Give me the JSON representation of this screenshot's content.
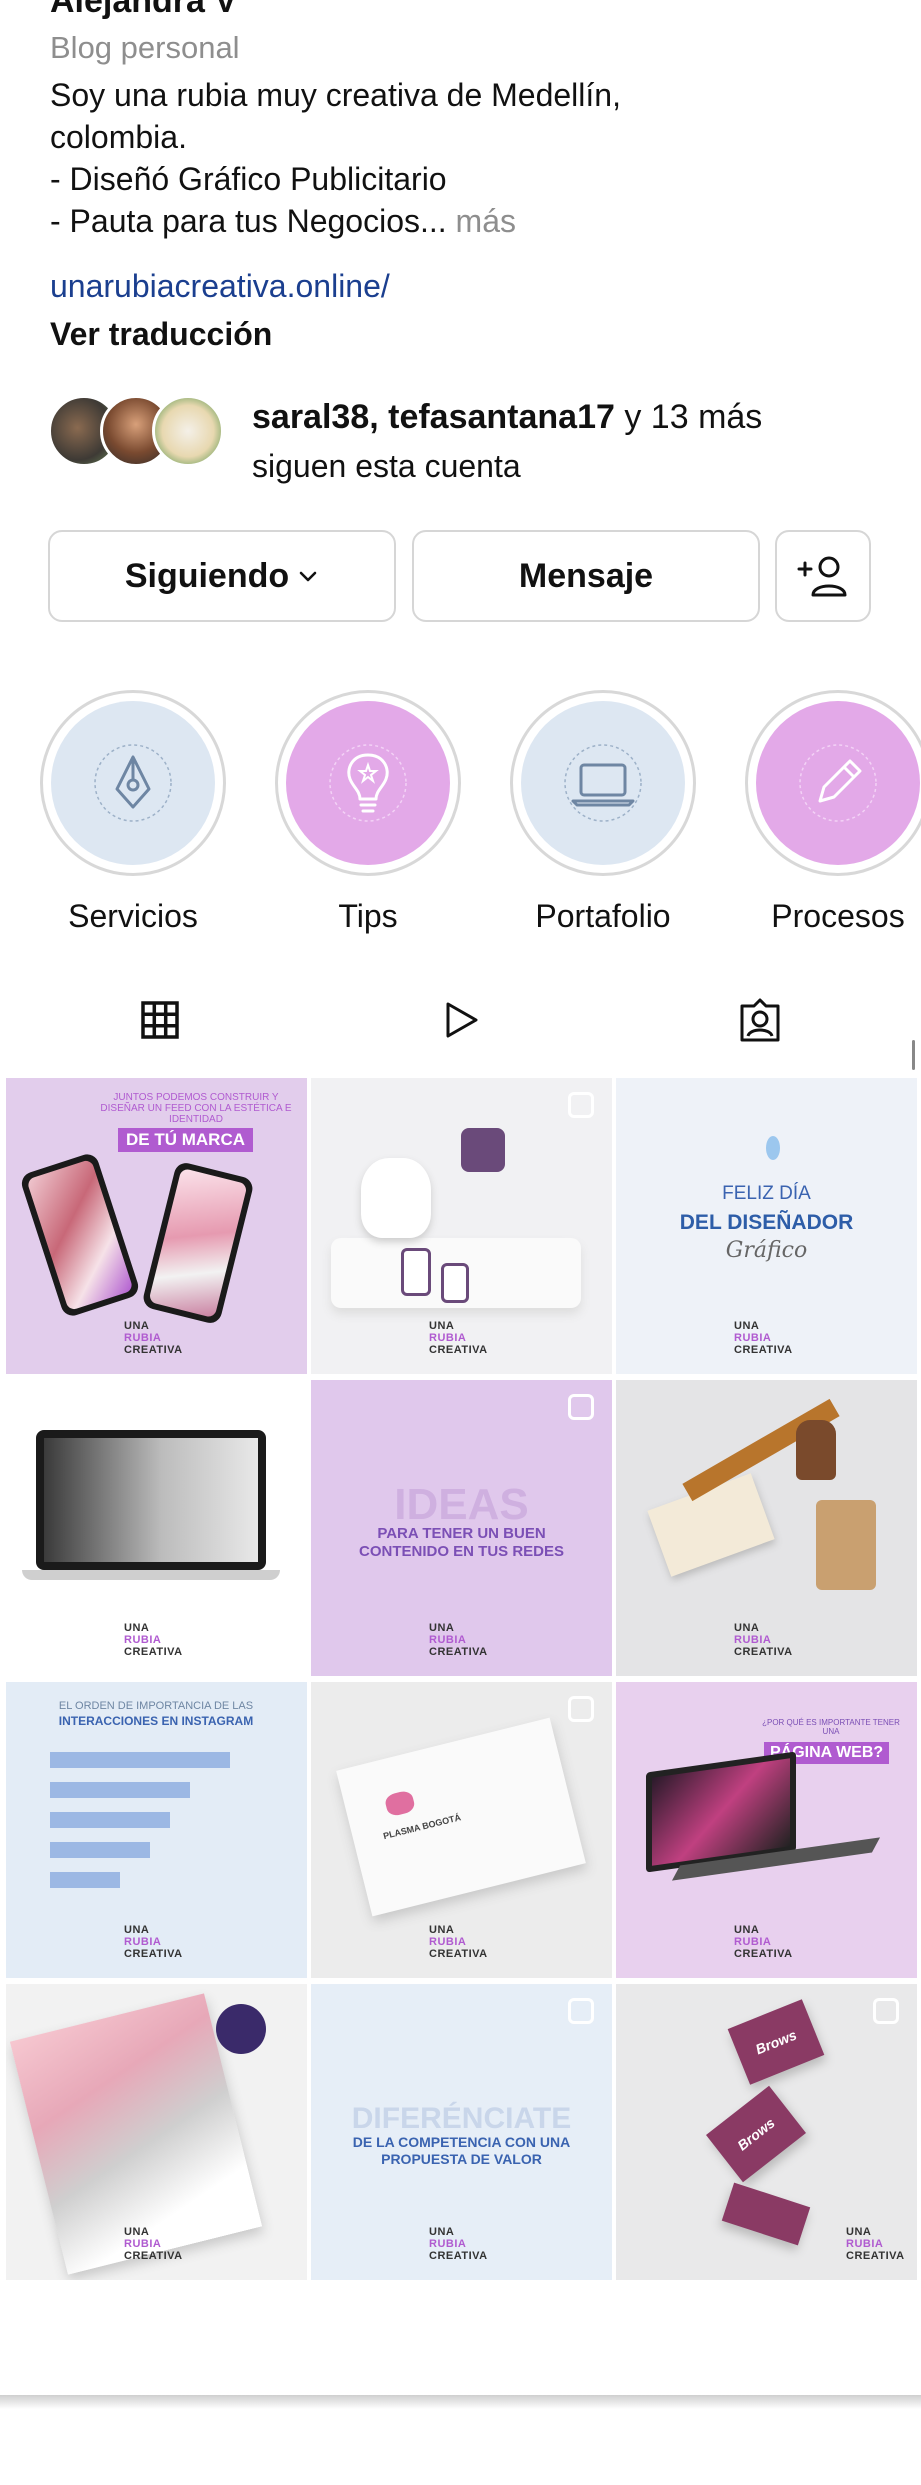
{
  "profile": {
    "name": "Alejandra V",
    "category": "Blog personal",
    "bio_lines": [
      "Soy una rubia muy creativa de Medellín,",
      "colombia.",
      "- Diseñó Gráfico Publicitario",
      "- Pauta para tus Negocios..."
    ],
    "more": "más",
    "link": "unarubiacreativa.online/",
    "translate": "Ver traducción"
  },
  "followed_by": {
    "names": "saral38, tefasantana17",
    "connector": "y 13 más",
    "suffix": "siguen esta cuenta"
  },
  "buttons": {
    "following": "Siguiendo",
    "message": "Mensaje",
    "add_user_icon": "add-user-icon"
  },
  "highlights": [
    {
      "label": "Servicios",
      "color": "#dde7f2",
      "icon": "pen-tool-icon"
    },
    {
      "label": "Tips",
      "color": "#e3a9e8",
      "icon": "lightbulb-icon"
    },
    {
      "label": "Portafolio",
      "color": "#dde7f2",
      "icon": "laptop-icon"
    },
    {
      "label": "Procesos",
      "color": "#e3a9e8",
      "icon": "pencil-icon"
    }
  ],
  "ring_text": "UNA RUBIA CREATIVA",
  "tabs": [
    "grid-icon",
    "reels-icon",
    "tagged-icon"
  ],
  "posts": [
    {
      "bg": "#e2cdec",
      "t1": "JUNTOS PODEMOS CONSTRUIR Y DISEÑAR UN FEED CON LA ESTÉTICA E IDENTIDAD",
      "t2": "DE TÚ MARCA",
      "t2color": "#ffffff",
      "t2bg": "#b05bd0"
    },
    {
      "bg": "#f1f1f3",
      "t1": "",
      "t2": "",
      "t2color": "#111",
      "t2bg": "transparent"
    },
    {
      "bg": "#eef2f8",
      "t1": "FELIZ DÍA",
      "t2": "DEL DISEÑADOR",
      "t2color": "#2d5da8",
      "t2bg": "transparent",
      "t3": "Gráfico"
    },
    {
      "bg": "#ffffff",
      "t1": "",
      "t2": "",
      "t2color": "#111",
      "t2bg": "transparent"
    },
    {
      "bg": "#e0c8ec",
      "t1": "IDEAS",
      "t2": "PARA TENER UN BUEN CONTENIDO EN TUS REDES",
      "t2color": "#7b4fb5",
      "t2bg": "transparent"
    },
    {
      "bg": "#e4e4e6",
      "t1": "",
      "t2": "",
      "t2color": "#111",
      "t2bg": "transparent"
    },
    {
      "bg": "#e3ecf6",
      "t1": "EL ORDEN DE IMPORTANCIA DE LAS",
      "t2": "INTERACCIONES EN INSTAGRAM",
      "t2color": "#3a63b0",
      "t2bg": "transparent"
    },
    {
      "bg": "#ececec",
      "t1": "PLASMA BOGOTÁ",
      "t2": "",
      "t2color": "#111",
      "t2bg": "transparent"
    },
    {
      "bg": "#e8d0ee",
      "t1": "¿POR QUÉ ES IMPORTANTE TENER UNA",
      "t2": "PÁGINA WEB?",
      "t2color": "#ffffff",
      "t2bg": "#b05bd0"
    },
    {
      "bg": "#f2f2f2",
      "t1": "",
      "t2": "",
      "t2color": "#111",
      "t2bg": "transparent"
    },
    {
      "bg": "#e6eef7",
      "t1": "DIFERÉNCIATE",
      "t2": "DE LA COMPETENCIA CON UNA PROPUESTA DE VALOR",
      "t2color": "#3a63b0",
      "t2bg": "transparent"
    },
    {
      "bg": "#e9e9ea",
      "t1": "Brows",
      "t2": "",
      "t2color": "#fff",
      "t2bg": "transparent"
    }
  ],
  "brand_mark": [
    "UNA",
    "RUBIA",
    "CREATIVA"
  ],
  "colors": {
    "accent": "#b05bd0",
    "link": "#1b3f8f",
    "muted": "#8e8e8e",
    "border": "#d6d6d6"
  }
}
